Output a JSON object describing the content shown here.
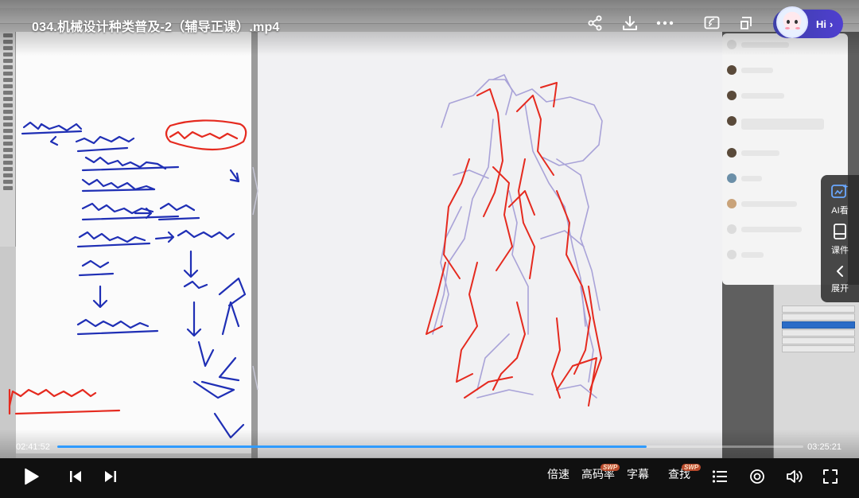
{
  "video": {
    "title": "034.机械设计种类普及-2（辅导正课）.mp4"
  },
  "top_bar": {
    "share_icon": "share-icon",
    "download_icon": "download-icon",
    "more_icon": "more-icon",
    "cast_icon": "cast-icon",
    "pip_icon": "pip-icon",
    "assistant_label": "Hi"
  },
  "side_menu": {
    "items": [
      {
        "label": "AI看",
        "icon": "ai-view-icon"
      },
      {
        "label": "课件",
        "icon": "courseware-icon"
      },
      {
        "label": "展开",
        "icon": "chevron-left-icon"
      }
    ]
  },
  "progress": {
    "current_time": "02:41:52",
    "total_time": "03:25:21",
    "fraction": 0.79
  },
  "controls": {
    "speed_label": "倍速",
    "quality_label": "高码率",
    "quality_badge": "SWP",
    "subtitle_label": "字幕",
    "search_label": "查找",
    "search_badge": "SWP"
  },
  "colors": {
    "accent": "#2f9bff",
    "sketch_red": "#e52a1f",
    "sketch_blue": "#1f2fb5",
    "sketch_lavender": "#a9a3d8"
  }
}
